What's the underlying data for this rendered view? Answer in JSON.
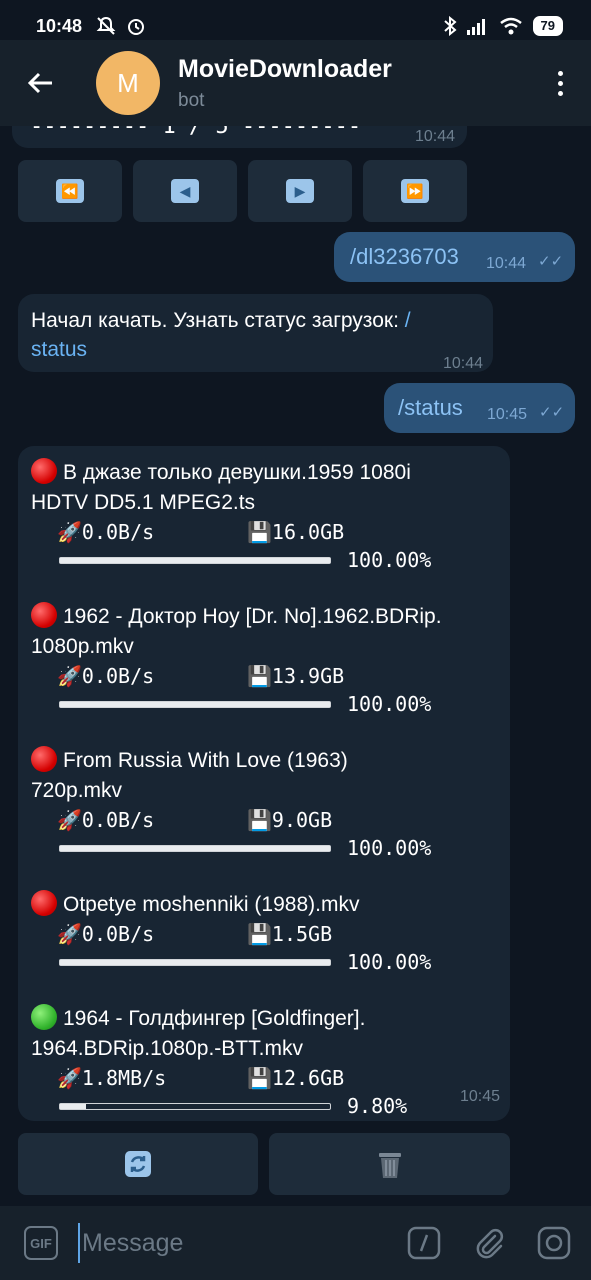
{
  "status_bar": {
    "time": "10:48",
    "battery": "79"
  },
  "header": {
    "avatar_letter": "M",
    "title": "MovieDownloader",
    "subtitle": "bot"
  },
  "messages": {
    "partial_text": "--------- 1 / 5 ---------",
    "partial_time": "10:44",
    "dl_command": "/dl3236703",
    "dl_time": "10:44",
    "started_text": "Начал качать. Узнать статус загрузок: ",
    "started_link_1": "/",
    "started_link_2": "status",
    "started_time": "10:44",
    "status_command": "/status",
    "status_time": "10:45"
  },
  "nav_buttons": [
    {
      "icon": "fast-backward-icon",
      "glyph": "⏪"
    },
    {
      "icon": "previous-icon",
      "glyph": "◀"
    },
    {
      "icon": "next-icon",
      "glyph": "▶"
    },
    {
      "icon": "fast-forward-icon",
      "glyph": "⏩"
    }
  ],
  "downloads": [
    {
      "status": "red",
      "title_1": "В джазе только девушки.1959 1080i",
      "title_2": "HDTV DD5.1 MPEG2.ts",
      "speed": "🚀0.0B/s",
      "size": "💾16.0GB",
      "progress": 1.0,
      "percent": "100.00%"
    },
    {
      "status": "red",
      "title_1": "1962 - Доктор Ноу [Dr. No].1962.BDRip.",
      "title_2": "1080p.mkv",
      "speed": "🚀0.0B/s",
      "size": "💾13.9GB",
      "progress": 1.0,
      "percent": "100.00%"
    },
    {
      "status": "red",
      "title_1": "From Russia With Love (1963)",
      "title_2": "720p.mkv",
      "speed": "🚀0.0B/s",
      "size": "💾9.0GB",
      "progress": 1.0,
      "percent": "100.00%"
    },
    {
      "status": "red",
      "title_1": "Otpetye moshenniki (1988).mkv",
      "title_2": "",
      "speed": "🚀0.0B/s",
      "size": "💾1.5GB",
      "progress": 1.0,
      "percent": "100.00%"
    },
    {
      "status": "green",
      "title_1": "1964 - Голдфингер [Goldfinger].",
      "title_2": "1964.BDRip.1080p.-BTT.mkv",
      "speed": "🚀1.8MB/s",
      "size": "💾12.6GB",
      "progress": 0.098,
      "percent": "9.80%"
    }
  ],
  "downloads_time": "10:45",
  "bottom_buttons": [
    {
      "icon": "refresh-icon",
      "glyph": "🔄"
    },
    {
      "icon": "trash-icon",
      "glyph": "🗑"
    }
  ],
  "input": {
    "placeholder": "Message",
    "gif_label": "GIF"
  },
  "colors": {
    "background": "#0e1621",
    "bubble_in": "#182533",
    "bubble_out": "#2b5278",
    "link": "#6ab3f3"
  }
}
